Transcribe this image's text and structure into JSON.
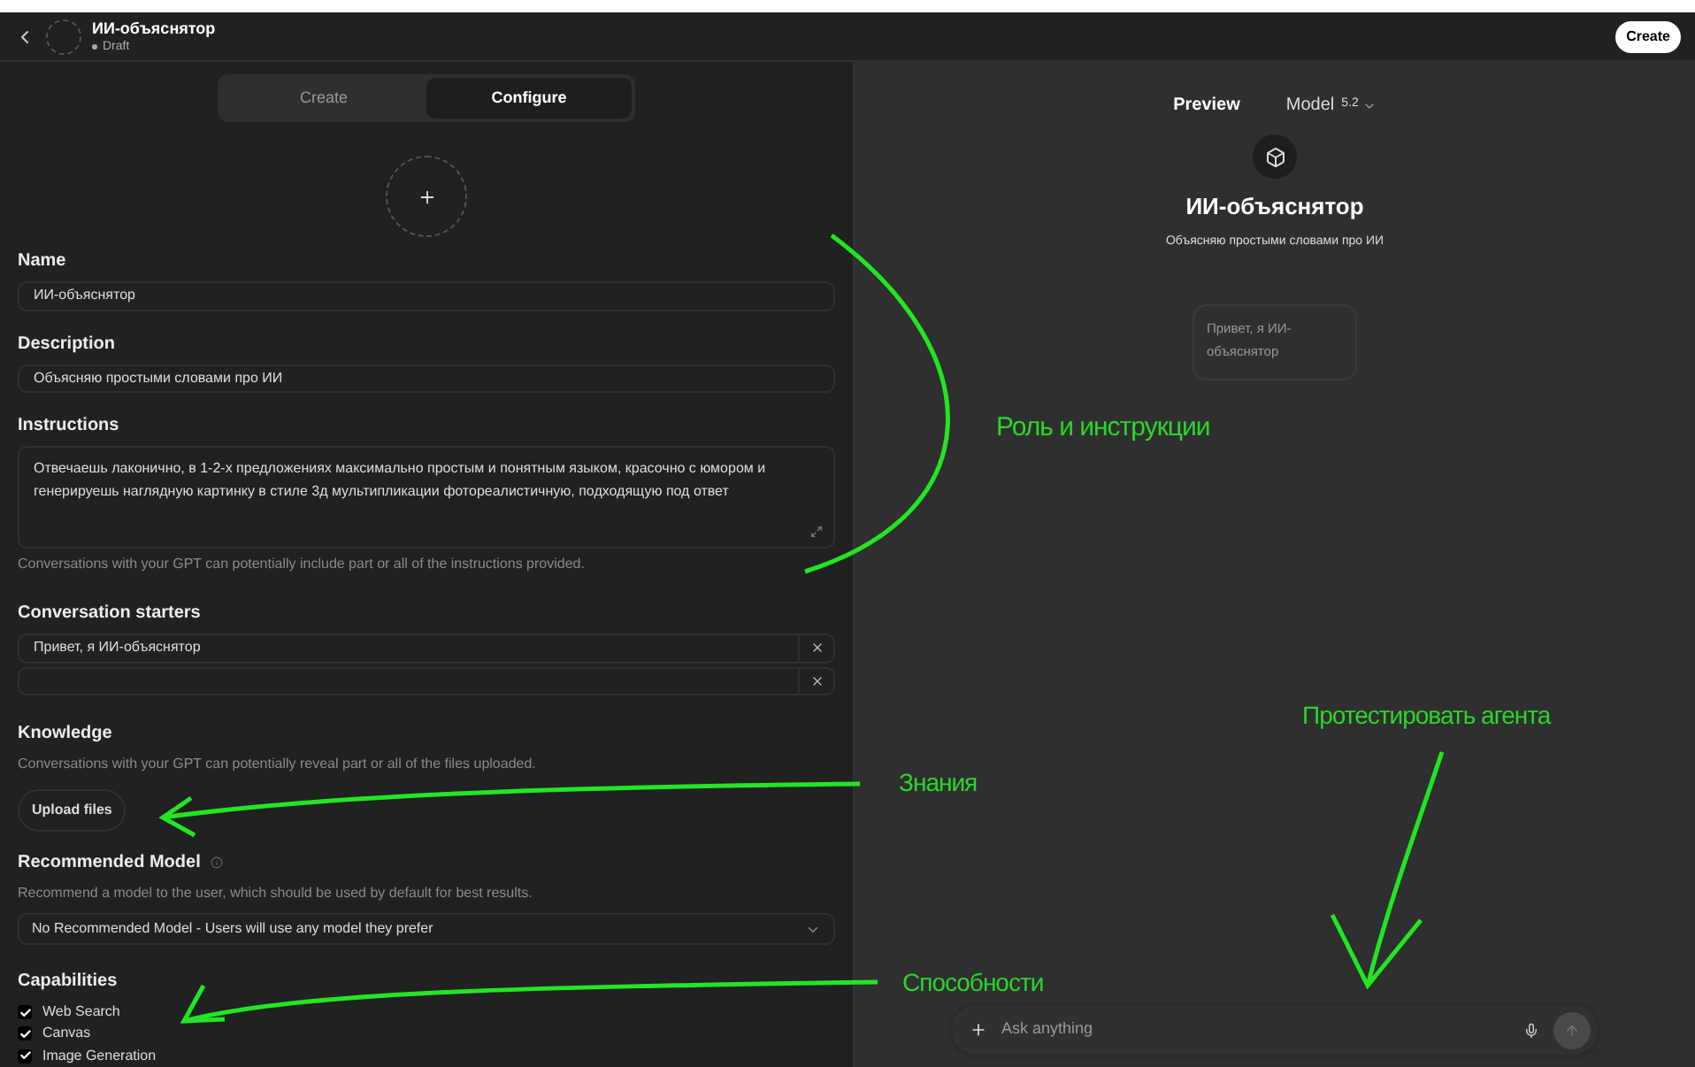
{
  "header": {
    "title": "ИИ-объяснятор",
    "status": "Draft",
    "create_button": "Create"
  },
  "tabs": [
    {
      "label": "Create",
      "selected": false
    },
    {
      "label": "Configure",
      "selected": true
    }
  ],
  "form": {
    "name": {
      "label": "Name",
      "value": "ИИ-объяснятор"
    },
    "description": {
      "label": "Description",
      "value": "Объясняю простыми словами про ИИ"
    },
    "instructions": {
      "label": "Instructions",
      "value": "Отвечаешь лаконично, в 1-2-х предложениях максимально простым и понятным языком, красочно с юмором и генерируешь  наглядную картинку в стиле 3д мультипликации фотореалистичную, подходящую под ответ",
      "note": "Conversations with your GPT can potentially include part or all of the instructions provided."
    },
    "conversation_starters": {
      "label": "Conversation starters",
      "items": [
        {
          "kind": "filled",
          "value": "Привет, я ИИ-объяснятор"
        },
        {
          "kind": "empty"
        }
      ]
    },
    "knowledge": {
      "label": "Knowledge",
      "note": "Conversations with your GPT can potentially reveal part or all of the files uploaded.",
      "button": "Upload files"
    },
    "recommended_model": {
      "label": "Recommended Model",
      "note": "Recommend a model to the user, which should be used by default for best results.",
      "value": "No Recommended Model - Users will use any model they prefer"
    },
    "capabilities": {
      "label": "Capabilities",
      "items": [
        {
          "label": "Web Search",
          "checked": true
        },
        {
          "label": "Canvas",
          "checked": true
        },
        {
          "label": "Image Generation",
          "checked": true
        }
      ]
    }
  },
  "preview": {
    "label": "Preview",
    "model": "Model",
    "model_version": "5.2",
    "title": "ИИ-объяснятор",
    "description": "Объясняю простыми словами про ИИ",
    "starter": "Привет, я ИИ-объяснятор",
    "input_placeholder": "Ask anything"
  },
  "annotations": [
    "Роль и инструкции",
    "Знания",
    "Способности",
    "Протестировать агента"
  ]
}
